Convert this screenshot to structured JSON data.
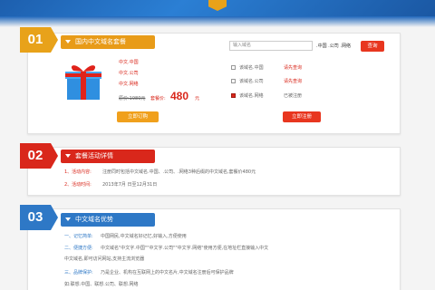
{
  "section1": {
    "number": "01",
    "header": "国内中文域名套餐",
    "products": [
      "中文.中国",
      "中文.公司",
      "中文.网络"
    ],
    "orig_price_label": "原价:1980元",
    "sale_price_label": "套餐价:",
    "sale_price": "480",
    "price_unit": "元",
    "buy_button": "立即订购",
    "search_placeholder": "输入域名",
    "suffix_text": ".中国 .公司 .网络",
    "query_button": "查询",
    "results": [
      {
        "name": "该域名.中国",
        "status": "请先查询",
        "checked": false
      },
      {
        "name": "该域名.公司",
        "status": "请先查询",
        "checked": false
      },
      {
        "name": "该域名.网络",
        "status": "已被注册",
        "checked": true
      }
    ],
    "register_button": "立即注册"
  },
  "section2": {
    "number": "02",
    "header": "套餐活动详情",
    "line1_label": "1、活动内容:",
    "line1_text": "注册同时包括中文域名.中国、.公司、.网络3种后缀的中文域名,套餐价480元",
    "line2_label": "2、活动时间:",
    "line2_text": "2013年7月 日至12月31日"
  },
  "section3": {
    "number": "03",
    "header": "中文域名优势",
    "line1_label": "一、记忆简单:",
    "line1_text": "中国网民,中文域名好记忆,好输入,方便使用",
    "line2_label": "二、便捷方便:",
    "line2_text": "中文域名\"中文字.中国\"\"中文字.公司\"\"中文字.网络\"使用方便,在地址栏直接输入中文",
    "line3_text": "中文域名,即可访问网站,支持主流浏览器",
    "line4_label": "三、品牌保护:",
    "line4_text": "乃是企业、机构在互联网上的中文名片,中文域名注册后可保护品牌",
    "line5_text": "如:联想.中国、联想.公司、联想.网络"
  }
}
